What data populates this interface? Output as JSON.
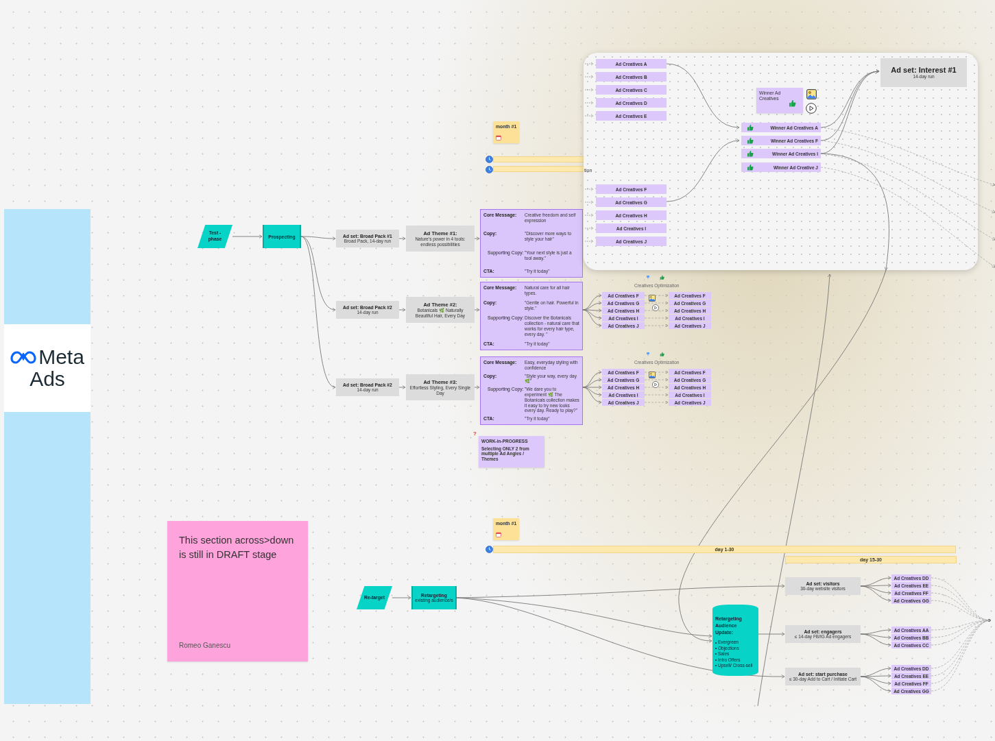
{
  "logo": {
    "brand": "Meta",
    "product": "Ads"
  },
  "draft_note": {
    "text": "This section across>down is still in DRAFT stage",
    "author": "Romeo Ganescu"
  },
  "prospecting": {
    "phase": "Test - phase",
    "stage": "Prospecting",
    "ad_sets": [
      {
        "title": "Ad set: Broad Pack #1",
        "subtitle": "Broad Pack, 14-day run",
        "theme_title": "Ad Theme #1:",
        "theme_text": "Nature's power in 4 tools: endless possibilities",
        "brief": [
          {
            "kind": "main",
            "label": "Core Message:",
            "text": "Creative freedom and self expression"
          },
          {
            "kind": "main",
            "label": "Copy:",
            "text": "\"Discover more ways to style your hair\""
          },
          {
            "kind": "sub",
            "label": "Supporting Copy:",
            "text": "\"Your next style is just a tool away.\""
          },
          {
            "kind": "main",
            "label": "CTA:",
            "text": "\"Try it today\""
          }
        ]
      },
      {
        "title": "Ad set: Broad Pack #2",
        "subtitle": "14-day run",
        "theme_title": "Ad Theme #2:",
        "theme_text": "Botanicals 🌿 Naturally Beautiful Hair, Every Day",
        "brief": [
          {
            "kind": "main",
            "label": "Core Message:",
            "text": "Natural care for all hair types."
          },
          {
            "kind": "main",
            "label": "Copy:",
            "text": "\"Gentle on hair. Powerful in style.\""
          },
          {
            "kind": "sub",
            "label": "Supporting Copy:",
            "text": "Discover the Botanicals collection - natural care that works for every hair type, every day. \""
          },
          {
            "kind": "main",
            "label": "CTA:",
            "text": "\"Try it today\""
          }
        ],
        "optimization": {
          "label": "Creatives Optimization",
          "creatives": [
            "Ad Creatives F",
            "Ad Creatives G",
            "Ad Creatives H",
            "Ad Creatives I",
            "Ad Creatives J"
          ],
          "optimized": [
            "Ad Creatives F",
            "Ad Creatives G",
            "Ad Creatives H",
            "Ad Creatives I",
            "Ad Creatives J"
          ]
        }
      },
      {
        "title": "Ad set: Broad Pack #2",
        "subtitle": "14-day run",
        "theme_title": "Ad Theme #3:",
        "theme_text": "Effortless Styling, Every Single Day",
        "brief": [
          {
            "kind": "main",
            "label": "Core Message:",
            "text": "Easy, everyday styling with confidence"
          },
          {
            "kind": "main",
            "label": "Copy:",
            "text": "\"Style your way, every day 🌿\""
          },
          {
            "kind": "sub",
            "label": "Supporting Copy:",
            "text": "\"We dare you to experiment 🌿 The Botanicals collection makes it easy to try new looks every day. Ready to play?\""
          },
          {
            "kind": "main",
            "label": "CTA:",
            "text": "\"Try it today\""
          }
        ],
        "optimization": {
          "label": "Creatives Optimization",
          "creatives": [
            "Ad Creatives F",
            "Ad Creatives G",
            "Ad Creatives H",
            "Ad Creatives I",
            "Ad Creatives J"
          ],
          "optimized": [
            "Ad Creatives F",
            "Ad Creatives G",
            "Ad Creatives H",
            "Ad Creatives I",
            "Ad Creatives J"
          ]
        }
      }
    ]
  },
  "winner_card": {
    "hidden_label": "tion",
    "creatives": [
      "Ad Creatives A",
      "Ad Creatives B",
      "Ad Creatives C",
      "Ad Creatives D",
      "Ad Creatives E",
      "Ad Creatives F",
      "Ad Creatives G",
      "Ad Creatives H",
      "Ad Creatives I",
      "Ad Creatives J"
    ],
    "winner_note": "Winner Ad Creatives",
    "winners": [
      "Winner Ad Creatives A",
      "Winner Ad Creatives F",
      "Winner Ad Creatives I",
      "Winner Ad Creative J"
    ],
    "ad_set": {
      "title": "Ad set: Interest #1",
      "subtitle": "14-day run"
    }
  },
  "timeline": {
    "months": [
      "month #1",
      "month #1"
    ],
    "bars": [
      {
        "label": "day 1-30"
      },
      {
        "label": "day 15-30"
      }
    ]
  },
  "wip_note": {
    "mark": "?",
    "title": "WORK-in-PROGRESS",
    "text": "Selecting ONLY 2 from multiple Ad Angles / Themes"
  },
  "retargeting": {
    "phase": "Re-target",
    "stage": "Retargeting",
    "stage_sub": "existing audience/s",
    "audience": {
      "title": "Retargeting Audience Update:",
      "items": [
        "Evergreen",
        "Objections",
        "Sales",
        "Intro Offers",
        "Upsell/ Cross-sell"
      ]
    },
    "ad_sets": [
      {
        "title": "Ad set: visitors",
        "subtitle": "30-day website visitors",
        "creatives": [
          "Ad Creatives DD",
          "Ad Creatives EE",
          "Ad Creatives FF",
          "Ad Creatives GG"
        ]
      },
      {
        "title": "Ad set: engagers",
        "subtitle": "≤ 14-day FB/IG Ad engagers",
        "creatives": [
          "Ad Creatives AA",
          "Ad Creatives BB",
          "Ad Creatives CC"
        ]
      },
      {
        "title": "Ad set: start purchase",
        "subtitle": "≤ 30-day Add to Cart / Initiate Cart",
        "creatives": [
          "Ad Creatives DD",
          "Ad Creatives EE",
          "Ad Creatives FF",
          "Ad Creatives GG"
        ]
      }
    ]
  }
}
